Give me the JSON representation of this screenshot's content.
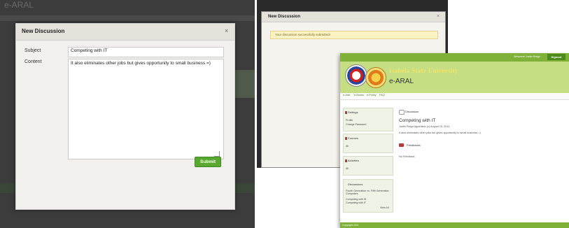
{
  "panel1": {
    "app_logo": "e-ARAL",
    "dialog_title": "New Discussion",
    "close_glyph": "×",
    "subject_label": "Subject",
    "subject_value": "Competing with IT",
    "content_label": "Content",
    "content_value": "It also eliminates other jobs but gives opportunity to small business =)",
    "submit_label": "Submit",
    "accent_color": "#5aa832"
  },
  "panel2": {
    "dialog_title": "New Discussion",
    "close_glyph": "×",
    "message": "Your discussion successfully submitted!"
  },
  "panel3": {
    "welcome": "Welcome Justin Reign",
    "signout": "Signout",
    "university": "Isabela State University",
    "app_name": "e-ARAL",
    "menu": [
      "e-Aral",
      "e-Books",
      "e-Policy",
      "FAQ"
    ],
    "sidebar": {
      "settings": {
        "title": "Settings",
        "items": [
          "Profile",
          "Change Password"
        ]
      },
      "courses": {
        "title": "Courses",
        "items": [
          "All"
        ]
      },
      "activities": {
        "title": "Activities",
        "items": [
          "All"
        ]
      },
      "discussions": {
        "title": "Discussions",
        "items": [
          "Fourth Generation vs. Fifth Generation Computers",
          "Competing with IS",
          "Competing with IT"
        ],
        "view_all": "View All"
      }
    },
    "main": {
      "section_label": "Discussion",
      "post_title": "Competing with IT",
      "post_meta": "Justin Reign Aguinaldo (c) August 10, 2011",
      "post_body": "It also eliminates other jobs but gives opportunity to small business =)",
      "feedbacks_label": "Feedbacks",
      "no_feedback": "No Feedback"
    },
    "footer": "Copyright 2011",
    "brand_green": "#7fb038"
  }
}
